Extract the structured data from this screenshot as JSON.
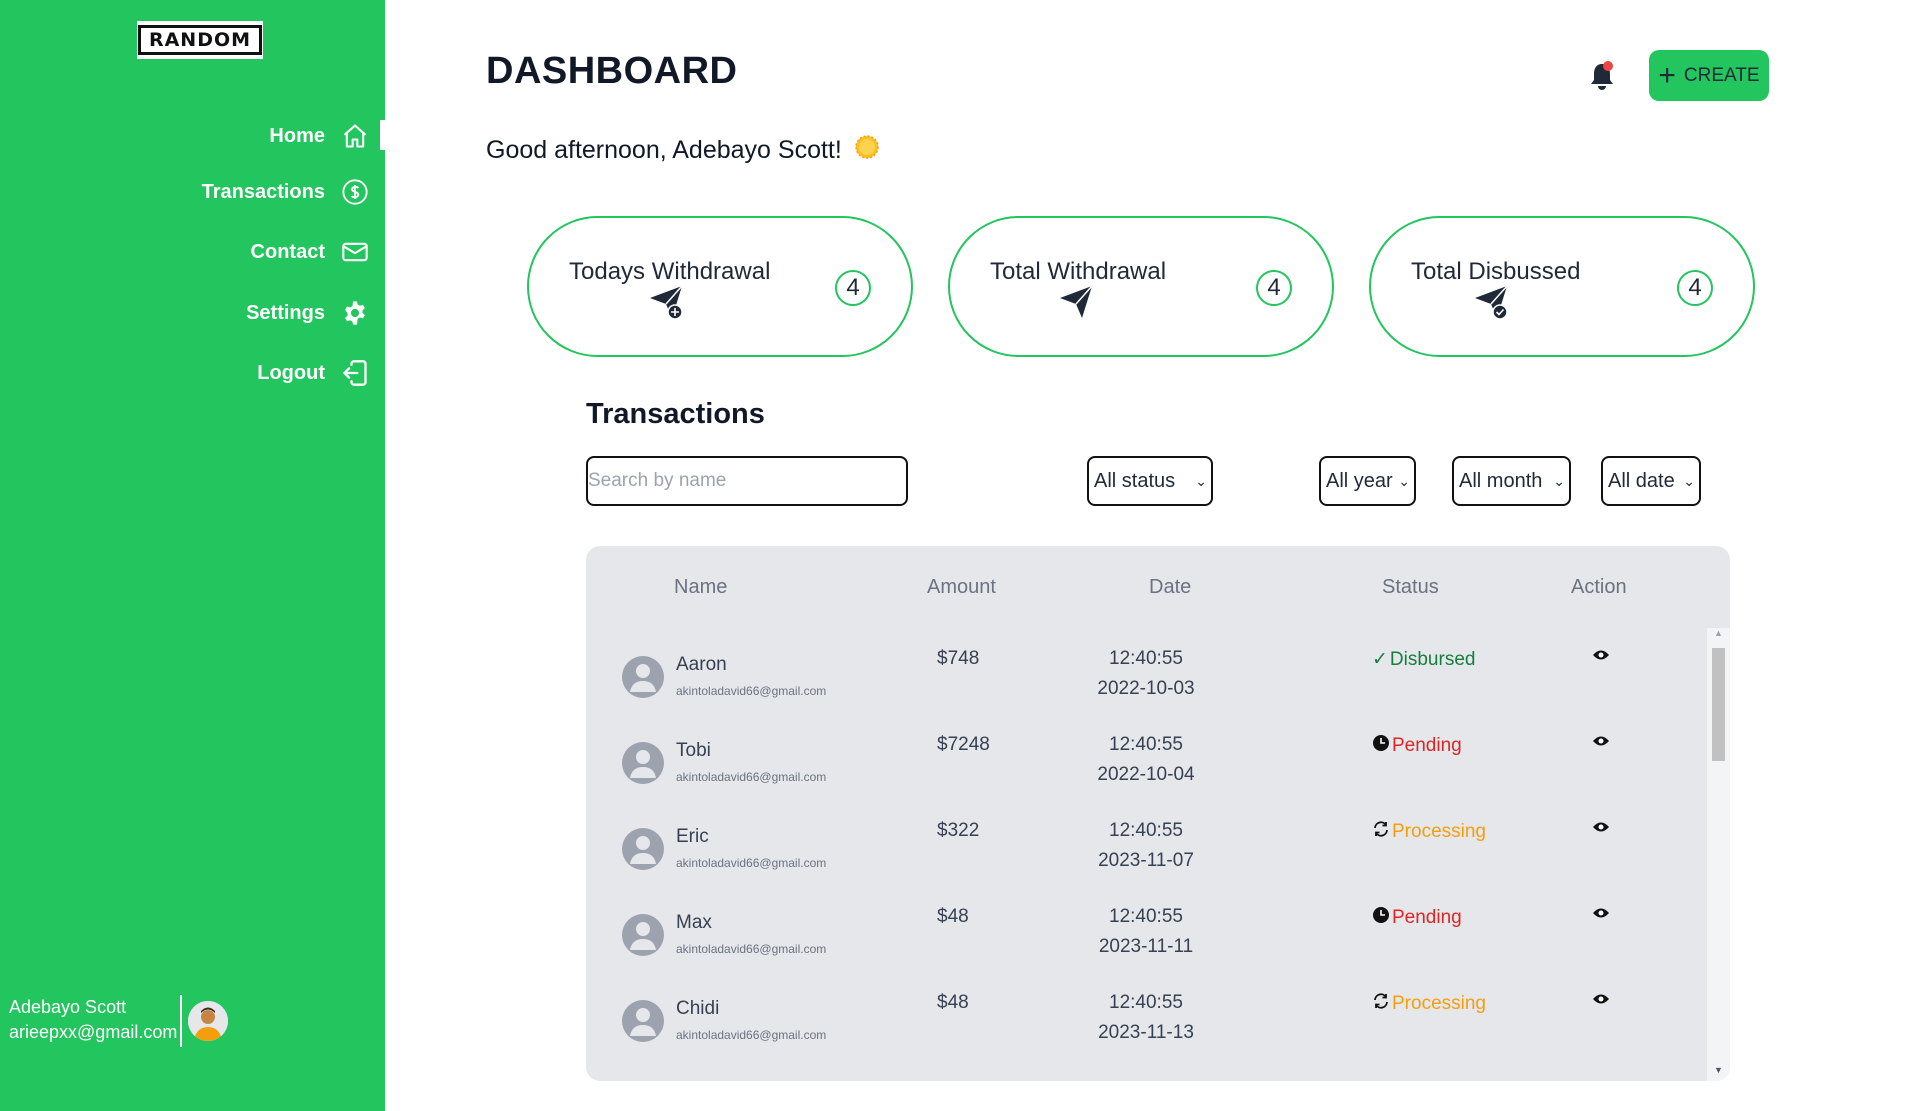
{
  "sidebar": {
    "logo_text": "RANDOM",
    "items": [
      {
        "label": "Home",
        "icon": "home-icon"
      },
      {
        "label": "Transactions",
        "icon": "dollar-circle-icon"
      },
      {
        "label": "Contact",
        "icon": "envelope-icon"
      },
      {
        "label": "Settings",
        "icon": "gear-icon"
      },
      {
        "label": "Logout",
        "icon": "logout-icon"
      }
    ],
    "active_item": "Home",
    "user": {
      "name": "Adebayo Scott",
      "email": "arieepxx@gmail.com"
    }
  },
  "header": {
    "title": "DASHBOARD",
    "greeting": "Good afternoon, Adebayo Scott!",
    "create_label": "CREATE",
    "notification_dot": true
  },
  "cards": [
    {
      "title": "Todays Withdrawal",
      "count": "4",
      "icon": "send-plus-icon"
    },
    {
      "title": "Total Withdrawal",
      "count": "4",
      "icon": "send-icon"
    },
    {
      "title": "Total Disbussed",
      "count": "4",
      "icon": "send-check-icon"
    }
  ],
  "transactions": {
    "title": "Transactions",
    "search_placeholder": "Search by name",
    "filters": {
      "status": "All status",
      "year": "All year",
      "month": "All month",
      "date": "All date"
    },
    "columns": [
      "Name",
      "Amount",
      "Date",
      "Status",
      "Action"
    ],
    "rows": [
      {
        "name": "Aaron",
        "email": "akintoladavid66@gmail.com",
        "amount": "$748",
        "time": "12:40:55",
        "date": "2022-10-03",
        "status": "Disbursed"
      },
      {
        "name": "Tobi",
        "email": "akintoladavid66@gmail.com",
        "amount": "$7248",
        "time": "12:40:55",
        "date": "2022-10-04",
        "status": "Pending"
      },
      {
        "name": "Eric",
        "email": "akintoladavid66@gmail.com",
        "amount": "$322",
        "time": "12:40:55",
        "date": "2023-11-07",
        "status": "Processing"
      },
      {
        "name": "Max",
        "email": "akintoladavid66@gmail.com",
        "amount": "$48",
        "time": "12:40:55",
        "date": "2023-11-11",
        "status": "Pending"
      },
      {
        "name": "Chidi",
        "email": "akintoladavid66@gmail.com",
        "amount": "$48",
        "time": "12:40:55",
        "date": "2023-11-13",
        "status": "Processing"
      }
    ]
  },
  "colors": {
    "accent": "#22c55e",
    "disbursed": "#15803d",
    "pending": "#dc2626",
    "processing": "#f59e0b"
  }
}
